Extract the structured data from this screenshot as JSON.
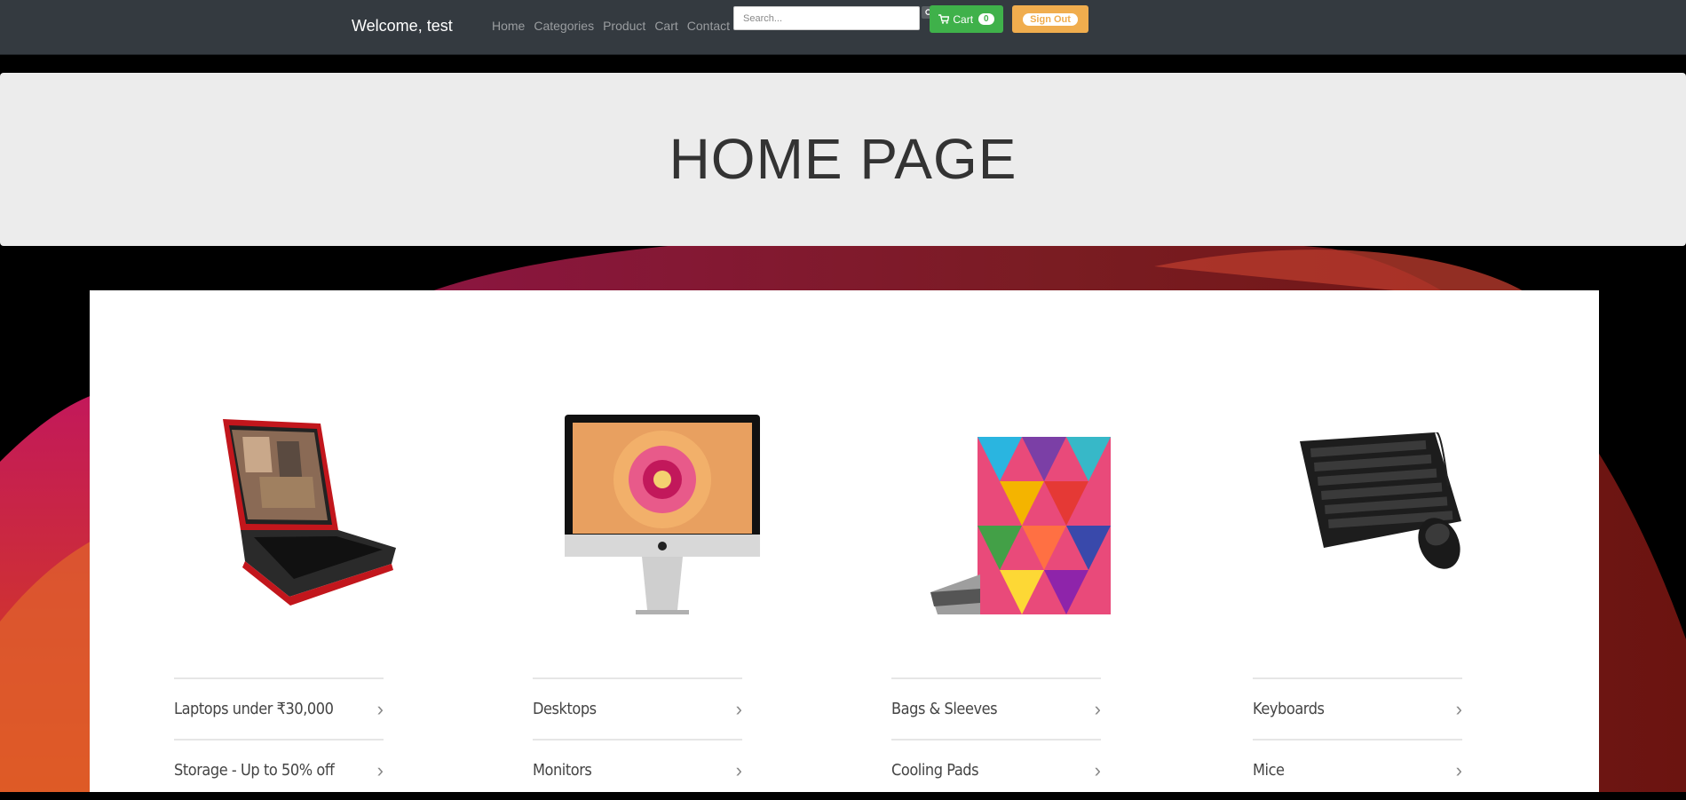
{
  "navbar": {
    "welcome": "Welcome, test",
    "links": [
      "Home",
      "Categories",
      "Product",
      "Cart",
      "Contact"
    ],
    "search_placeholder": "Search...",
    "cart_label": "Cart",
    "cart_count": "0",
    "signout_label": "Sign Out"
  },
  "hero": {
    "title": "HOME PAGE"
  },
  "columns": [
    {
      "image": "laptop",
      "links": [
        "Laptops under ₹30,000",
        "Storage - Up to 50% off"
      ]
    },
    {
      "image": "desktop",
      "links": [
        "Desktops",
        "Monitors"
      ]
    },
    {
      "image": "laptop-skin",
      "links": [
        "Bags & Sleeves",
        "Cooling Pads"
      ]
    },
    {
      "image": "keyboard-mouse",
      "links": [
        "Keyboards",
        "Mice"
      ]
    }
  ],
  "colors": {
    "navbar": "#343a40",
    "cart_green": "#3fb14a",
    "signout_orange": "#f0ad4e",
    "hero_bg": "#ececec"
  }
}
